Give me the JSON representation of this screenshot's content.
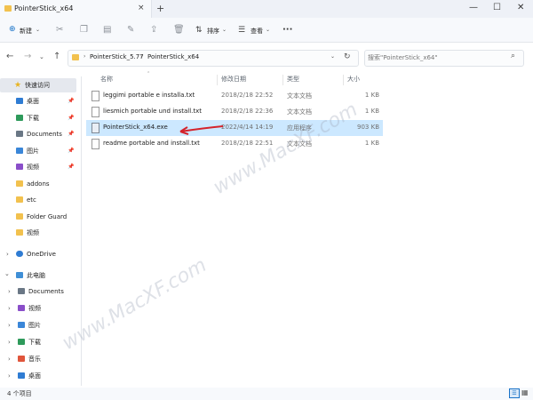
{
  "window": {
    "title": "PointerStick_x64",
    "tab_close": "×",
    "new_tab": "+",
    "minimize": "—",
    "maximize": "☐",
    "close": "✕"
  },
  "toolbar": {
    "new_label": "新建",
    "sort_label": "排序",
    "view_label": "查看",
    "more_label": "···"
  },
  "address": {
    "crumbs": [
      "PointerStick_5.77",
      "PointerStick_x64"
    ],
    "search_placeholder": "搜索\"PointerStick_x64\""
  },
  "sidebar": {
    "quick_access": "快速访问",
    "quick_items": [
      {
        "label": "桌面",
        "icon": "desktop-icon",
        "color": "#2f7cd3"
      },
      {
        "label": "下载",
        "icon": "download-icon",
        "color": "#2e9a5b"
      },
      {
        "label": "Documents",
        "icon": "document-icon",
        "color": "#6a7785"
      },
      {
        "label": "图片",
        "icon": "pictures-icon",
        "color": "#3a86d8"
      },
      {
        "label": "视频",
        "icon": "videos-icon",
        "color": "#8a4ec9"
      },
      {
        "label": "addons",
        "icon": "folder-icon",
        "color": "#f2c14e"
      },
      {
        "label": "etc",
        "icon": "folder-icon",
        "color": "#f2c14e"
      },
      {
        "label": "Folder Guard",
        "icon": "folder-icon",
        "color": "#f2c14e"
      },
      {
        "label": "视频",
        "icon": "folder-icon",
        "color": "#f2c14e"
      }
    ],
    "onedrive": "OneDrive",
    "this_pc": "此电脑",
    "pc_items": [
      {
        "label": "Documents",
        "icon": "document-icon",
        "color": "#6a7785"
      },
      {
        "label": "视频",
        "icon": "videos-icon",
        "color": "#8a4ec9"
      },
      {
        "label": "图片",
        "icon": "pictures-icon",
        "color": "#3a86d8"
      },
      {
        "label": "下载",
        "icon": "download-icon",
        "color": "#2e9a5b"
      },
      {
        "label": "音乐",
        "icon": "music-icon",
        "color": "#e0553b"
      },
      {
        "label": "桌面",
        "icon": "desktop-icon",
        "color": "#2f7cd3"
      }
    ]
  },
  "columns": {
    "name": "名称",
    "date": "修改日期",
    "type": "类型",
    "size": "大小"
  },
  "files": [
    {
      "name": "leggimi portable e installa.txt",
      "date": "2018/2/18 22:52",
      "type": "文本文档",
      "size": "1 KB"
    },
    {
      "name": "liesmich portable und install.txt",
      "date": "2018/2/18 22:36",
      "type": "文本文档",
      "size": "1 KB"
    },
    {
      "name": "PointerStick_x64.exe",
      "date": "2022/4/14 14:19",
      "type": "应用程序",
      "size": "903 KB"
    },
    {
      "name": "readme portable and install.txt",
      "date": "2018/2/18 22:51",
      "type": "文本文档",
      "size": "1 KB"
    }
  ],
  "status": {
    "count": "4 个项目"
  },
  "watermark": "www.MacXF.com"
}
